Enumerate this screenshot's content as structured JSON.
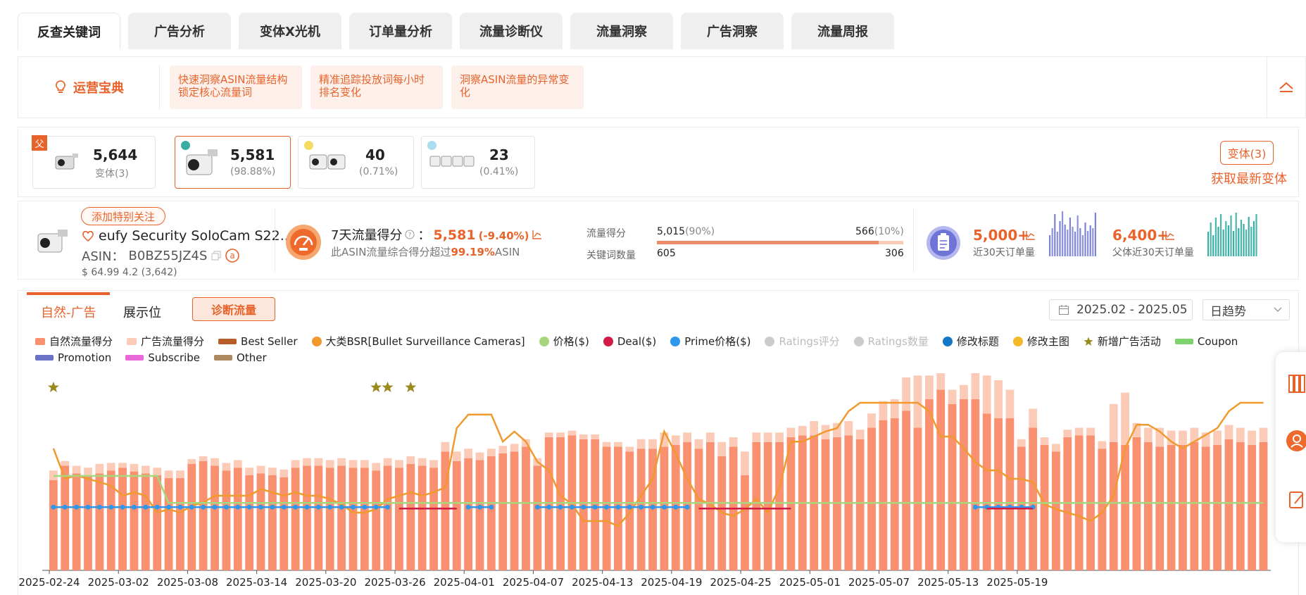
{
  "tabs": [
    "反查关键词",
    "广告分析",
    "变体X光机",
    "订单量分析",
    "流量诊断仪",
    "流量洞察",
    "广告洞察",
    "流量周报"
  ],
  "ops": {
    "title": "运营宝典",
    "chips": [
      "快速洞察ASIN流量结构锁定核心流量词",
      "精准追踪投放词每小时排名变化",
      "洞察ASIN流量的异常变化"
    ]
  },
  "variants": {
    "cards": [
      {
        "value": "5,644",
        "sub": "变体(3)",
        "badge": "父"
      },
      {
        "value": "5,581",
        "sub": "(98.88%)",
        "dot": "#3aaea4"
      },
      {
        "value": "40",
        "sub": "(0.71%)",
        "dot": "#f4dc62"
      },
      {
        "value": "23",
        "sub": "(0.41%)",
        "dot": "#a9dcee"
      }
    ],
    "variant_button": "变体(3)",
    "refresh_link": "获取最新变体"
  },
  "product": {
    "follow_button": "添加特别关注",
    "name": "eufy Security SoloCam S22...",
    "asin_label": "ASIN：",
    "asin": "B0BZ55JZ4S",
    "price_line": "$ 64.99  4.2  (3,642)"
  },
  "score": {
    "title": "7天流量得分",
    "value": "5,581",
    "change": "(-9.40%)",
    "sub_prefix": "此ASIN流量综合得分超过",
    "sub_pct": "99.19%",
    "sub_suffix": "ASIN",
    "traffic_label": "流量得分",
    "traffic_left": "5,015",
    "traffic_left_pct": "(90%)",
    "traffic_right": "566",
    "traffic_right_pct": "(10%)",
    "traffic_fill": 0.9,
    "kw_label": "关键词数量",
    "kw_left": "605",
    "kw_right": "306"
  },
  "orders": {
    "child_value": "5,000+",
    "child_label": "近30天订单量",
    "parent_value": "6,400+",
    "parent_label": "父体近30天订单量"
  },
  "chart_panel": {
    "subtabs": [
      "自然-广告",
      "展示位"
    ],
    "diag_button": "诊断流量",
    "date_range": "2025.02 - 2025.05",
    "trend_select": "日趋势"
  },
  "legend": [
    {
      "label": "自然流量得分",
      "color": "#f9906f",
      "shape": "box"
    },
    {
      "label": "广告流量得分",
      "color": "#fccbb7",
      "shape": "box"
    },
    {
      "label": "Best Seller",
      "color": "#b85c2c",
      "shape": "line"
    },
    {
      "label": "大类BSR[Bullet Surveillance Cameras]",
      "color": "#f09a2e",
      "shape": "circle"
    },
    {
      "label": "价格($)",
      "color": "#a6d67e",
      "shape": "circle"
    },
    {
      "label": "Deal($)",
      "color": "#d01c47",
      "shape": "circle"
    },
    {
      "label": "Prime价格($)",
      "color": "#2f97ec",
      "shape": "circle"
    },
    {
      "label": "Ratings评分",
      "color": "#cccccc",
      "shape": "circle",
      "off": true
    },
    {
      "label": "Ratings数量",
      "color": "#cccccc",
      "shape": "circle",
      "off": true
    },
    {
      "label": "修改标题",
      "color": "#1478c8",
      "shape": "circle"
    },
    {
      "label": "修改主图",
      "color": "#f4b82a",
      "shape": "circle"
    },
    {
      "label": "新增广告活动",
      "color": "#9a8a1c",
      "shape": "star"
    },
    {
      "label": "Coupon",
      "color": "#7dd36b",
      "shape": "line"
    },
    {
      "label": "Promotion",
      "color": "#6a73c8",
      "shape": "line"
    },
    {
      "label": "Subscribe",
      "color": "#e968da",
      "shape": "line"
    },
    {
      "label": "Other",
      "color": "#ad8962",
      "shape": "line"
    }
  ],
  "chart_data": {
    "type": "bar",
    "x_ticks": [
      "2025-02-24",
      "2025-03-02",
      "2025-03-08",
      "2025-03-14",
      "2025-03-20",
      "2025-03-26",
      "2025-04-01",
      "2025-04-07",
      "2025-04-13",
      "2025-04-19",
      "2025-04-25",
      "2025-05-01",
      "2025-05-07",
      "2025-05-13",
      "2025-05-19"
    ],
    "series": [
      {
        "name": "自然流量得分",
        "values": [
          95,
          110,
          102,
          100,
          102,
          105,
          108,
          104,
          102,
          100,
          97,
          97,
          112,
          115,
          110,
          105,
          108,
          100,
          102,
          100,
          98,
          108,
          110,
          110,
          108,
          110,
          108,
          108,
          105,
          110,
          108,
          112,
          110,
          108,
          125,
          115,
          118,
          116,
          120,
          123,
          125,
          130,
          110,
          140,
          140,
          142,
          138,
          138,
          130,
          130,
          125,
          128,
          128,
          130,
          132,
          135,
          128,
          135,
          120,
          130,
          100,
          135,
          135,
          135,
          140,
          142,
          142,
          138,
          140,
          142,
          138,
          150,
          158,
          160,
          168,
          150,
          180,
          190,
          175,
          180,
          180,
          165,
          160,
          160,
          130,
          150,
          132,
          125,
          140,
          142,
          142,
          128,
          135,
          132,
          140,
          135,
          130,
          132,
          132,
          135,
          130,
          132,
          138,
          135,
          132,
          135
        ]
      },
      {
        "name": "广告流量得分",
        "values": [
          10,
          5,
          8,
          8,
          10,
          8,
          5,
          8,
          8,
          8,
          8,
          8,
          5,
          5,
          8,
          8,
          8,
          8,
          8,
          8,
          8,
          8,
          8,
          8,
          8,
          8,
          8,
          8,
          8,
          8,
          8,
          8,
          8,
          8,
          10,
          10,
          10,
          8,
          8,
          8,
          8,
          8,
          8,
          5,
          5,
          5,
          5,
          5,
          5,
          5,
          5,
          10,
          10,
          15,
          10,
          10,
          10,
          10,
          15,
          10,
          25,
          10,
          10,
          10,
          10,
          10,
          15,
          15,
          15,
          15,
          10,
          15,
          20,
          20,
          35,
          55,
          25,
          20,
          15,
          15,
          40,
          40,
          40,
          30,
          8,
          20,
          8,
          8,
          8,
          8,
          8,
          8,
          40,
          55,
          15,
          15,
          20,
          15,
          15,
          15,
          15,
          15,
          15,
          15,
          15,
          15
        ]
      },
      {
        "name": "大类BSR[Bullet Surveillance Cameras]",
        "values": [
          68,
          50,
          52,
          50,
          48,
          46,
          40,
          42,
          40,
          30,
          32,
          30,
          34,
          36,
          40,
          40,
          40,
          40,
          44,
          42,
          40,
          42,
          40,
          40,
          38,
          35,
          30,
          30,
          32,
          38,
          40,
          42,
          40,
          42,
          45,
          80,
          88,
          88,
          88,
          72,
          78,
          72,
          60,
          55,
          40,
          35,
          25,
          25,
          25,
          22,
          30,
          40,
          50,
          78,
          65,
          50,
          38,
          35,
          30,
          28,
          32,
          38,
          30,
          45,
          72,
          72,
          75,
          78,
          80,
          90,
          95,
          95,
          95,
          95,
          95,
          95,
          90,
          75,
          75,
          68,
          60,
          55,
          55,
          50,
          50,
          48,
          35,
          32,
          30,
          28,
          25,
          30,
          40,
          68,
          82,
          82,
          78,
          72,
          68,
          72,
          76,
          80,
          90,
          95,
          95,
          95
        ]
      },
      {
        "name": "价格($)",
        "values": [
          74.99,
          74.99,
          74.99,
          74.99,
          74.99,
          74.99,
          74.99,
          74.99,
          74.99,
          74.99,
          64.99,
          64.99,
          64.99,
          64.99,
          64.99,
          64.99,
          64.99,
          64.99,
          64.99,
          64.99,
          64.99,
          64.99,
          64.99,
          64.99,
          64.99,
          64.99,
          64.99,
          64.99,
          64.99,
          64.99,
          64.99,
          64.99,
          64.99,
          64.99,
          64.99,
          64.99,
          64.99,
          64.99,
          64.99,
          64.99,
          64.99,
          64.99,
          64.99,
          64.99,
          64.99,
          64.99,
          64.99,
          64.99,
          64.99,
          64.99,
          64.99,
          64.99,
          64.99,
          64.99,
          64.99,
          64.99,
          64.99,
          64.99,
          64.99,
          64.99,
          64.99,
          64.99,
          64.99,
          64.99,
          64.99,
          64.99,
          64.99,
          64.99,
          64.99,
          64.99,
          64.99,
          64.99,
          64.99,
          64.99,
          64.99,
          64.99,
          64.99,
          64.99,
          64.99,
          64.99,
          64.99,
          64.99,
          64.99,
          64.99,
          64.99,
          64.99,
          64.99,
          64.99,
          64.99,
          64.99,
          64.99,
          64.99,
          64.99,
          64.99,
          64.99,
          64.99,
          64.99,
          64.99,
          64.99,
          64.99,
          64.99,
          64.99,
          64.99,
          64.99,
          64.99,
          64.99
        ]
      },
      {
        "name": "Prime价格($)",
        "segments": [
          [
            0,
            29
          ],
          [
            36,
            38
          ],
          [
            42,
            55
          ],
          [
            80,
            85
          ]
        ]
      },
      {
        "name": "Deal($)",
        "segments": [
          [
            30,
            35
          ],
          [
            56,
            64
          ],
          [
            81,
            85
          ]
        ]
      }
    ],
    "ad_campaign_stars": [
      0,
      28,
      29,
      31
    ],
    "ylim": [
      0,
      200
    ],
    "legend_placement": "top"
  }
}
